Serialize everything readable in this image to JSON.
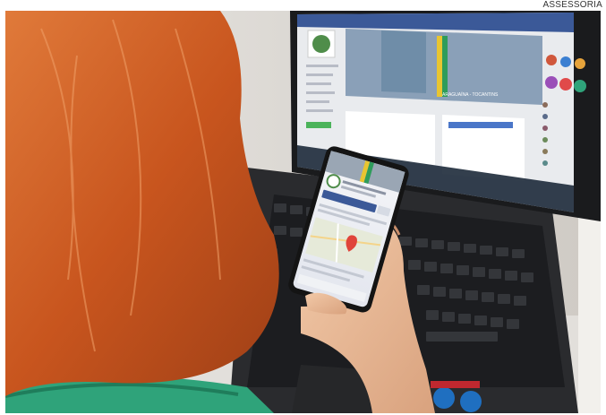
{
  "photo": {
    "caption": "ASSESSORIA",
    "description_tags": [
      "person-red-hair",
      "smartphone",
      "laptop",
      "facebook-page"
    ]
  },
  "laptop_screen": {
    "banner_text": "ARAGUAÍNA - TOCANTINS",
    "sidebar_title": "Prefeitura Municipal"
  },
  "phone_screen": {
    "header_text": "Prefeitura Municipal",
    "button_text": "Enviar mensagem"
  },
  "colors": {
    "fb_blue": "#3b5998",
    "hair": "#c8551e",
    "shirt": "#2fa37a",
    "laptop": "#2a2b2e"
  }
}
